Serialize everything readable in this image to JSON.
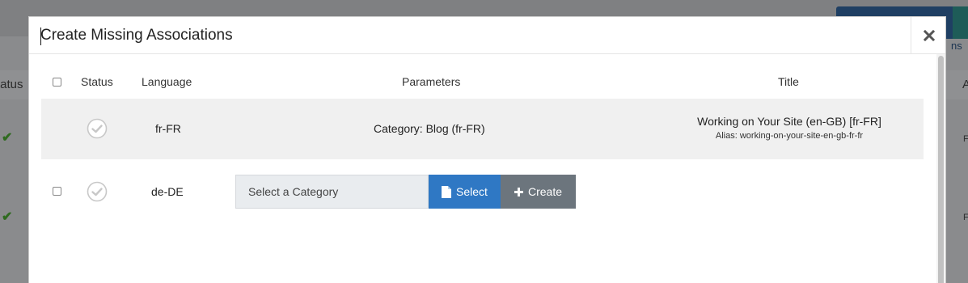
{
  "background": {
    "column_status_fragment": "tatus",
    "column_a_fragment": "A",
    "partial_button_fragment": "ns"
  },
  "modal": {
    "title": "Create Missing Associations",
    "close_icon": "close-icon"
  },
  "table": {
    "headers": {
      "status": "Status",
      "language": "Language",
      "parameters": "Parameters",
      "title": "Title"
    },
    "rows": [
      {
        "language": "fr-FR",
        "parameters": "Category: Blog (fr-FR)",
        "title": "Working on Your Site (en-GB) [fr-FR]",
        "alias": "Alias: working-on-your-site-en-gb-fr-fr",
        "status_icon": "check-circle-icon"
      },
      {
        "language": "de-DE",
        "status_icon": "check-circle-icon",
        "category_placeholder": "Select a Category",
        "select_label": "Select",
        "create_label": "Create"
      }
    ]
  },
  "colors": {
    "primary": "#2f78c4",
    "secondary": "#6c757d",
    "row_highlight": "#f0f0f0"
  }
}
